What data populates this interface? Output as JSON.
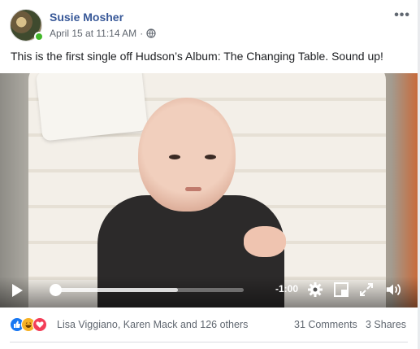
{
  "post": {
    "author": "Susie Mosher",
    "date": "April 15 at 11:14 AM",
    "separator": "·",
    "privacy_icon": "globe-icon",
    "more_label": "•••",
    "caption": "This is the first single off Hudson’s Album: The Changing Table. Sound up!"
  },
  "video": {
    "time_remaining": "-1:00",
    "progress": 0.65,
    "icons": [
      "play-icon",
      "gear-icon",
      "miniplayer-icon",
      "fullscreen-icon",
      "volume-icon"
    ]
  },
  "footer": {
    "reactions": [
      "like",
      "haha",
      "love"
    ],
    "reactors": "Lisa Viggiano, Karen Mack and 126 others",
    "comments": "31 Comments",
    "shares": "3 Shares"
  },
  "colors": {
    "author": "#385898",
    "online": "#42b72a",
    "like": "#1877f2",
    "haha": "#f7b125",
    "love": "#f33e58"
  }
}
